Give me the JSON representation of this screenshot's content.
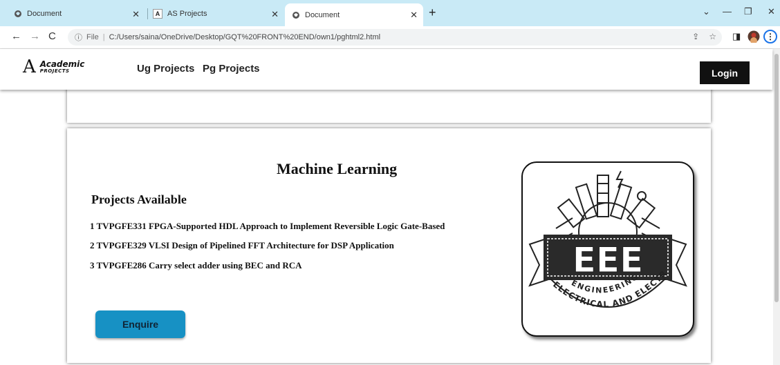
{
  "browser": {
    "tabs": [
      {
        "title": "Document",
        "icon": "globe-icon"
      },
      {
        "title": "AS Projects",
        "icon": "site-favicon"
      },
      {
        "title": "Document",
        "icon": "globe-icon",
        "active": true
      }
    ],
    "tab_favicon_letter": "A",
    "address": {
      "prefix": "File",
      "url": "C:/Users/saina/OneDrive/Desktop/GQT%20FRONT%20END/own1/pghtml2.html"
    }
  },
  "site": {
    "logo": {
      "line1": "Academic",
      "line2": "PROJECTS",
      "mark": "A"
    },
    "nav": [
      {
        "label": "Ug Projects"
      },
      {
        "label": "Pg Projects"
      }
    ],
    "login_label": "Login"
  },
  "main": {
    "title": "Machine Learning",
    "subtitle": "Projects Available",
    "projects": [
      "1 TVPGFE331 FPGA-Supported HDL Approach to Implement Reversible Logic Gate-Based",
      "2 TVPGFE329 VLSI Design of Pipelined FFT Architecture for DSP Application",
      "3 TVPGFE286 Carry select adder using BEC and RCA"
    ],
    "enquire_label": "Enquire",
    "emblem": {
      "big_text": "EEE",
      "arc1": "ENGINEERING",
      "arc2": "ELECTRICAL AND ELECTRONIC"
    }
  },
  "colors": {
    "enquire_button": "#1791c4",
    "tab_strip": "#c9eaf6",
    "login_button": "#111111"
  }
}
